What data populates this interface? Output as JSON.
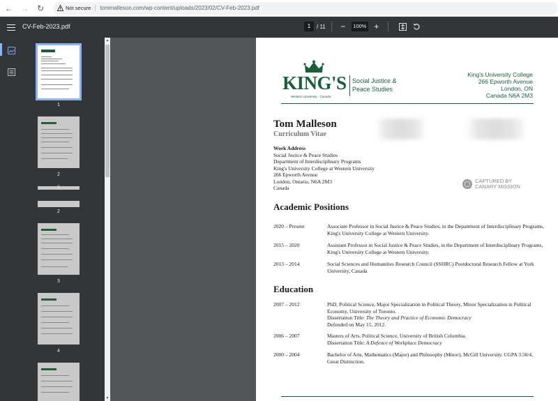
{
  "browser": {
    "not_secure": "Not secure",
    "url": "tommalleson.com/wp-content/uploads/2023/02/CV-Feb-2023.pdf"
  },
  "toolbar": {
    "file_name": "CV-Feb-2023.pdf",
    "current_page": "1",
    "total_pages": "/ 11",
    "zoom": "100%"
  },
  "thumbnails": {
    "labels": [
      "1",
      "2",
      "2",
      "2",
      "3",
      "4"
    ]
  },
  "document": {
    "logo_text": "KING'S",
    "logo_sub": "Social Justice & Peace Studies",
    "logo_tag": "Western University · Canada",
    "address_right": [
      "King's University College",
      "266 Epworth Avenue",
      "London, ON",
      "Canada N6A 2M3"
    ],
    "name": "Tom Malleson",
    "subtitle": "Curriculum Vitae",
    "work_address_label": "Work Address",
    "work_address": [
      "Social Justice & Peace Studies",
      "Department of Interdisciplinary Programs",
      "King's University College at Western University",
      "266 Epworth Avenue",
      "London, Ontario, N6A 2M3",
      "Canada"
    ],
    "captured": [
      "CAPTURED BY",
      "CANARY MISSION"
    ],
    "academic_title": "Academic Positions",
    "academic": [
      {
        "years": "2020 – Present",
        "desc": "Associate Professor in Social Justice & Peace Studies, in the Department of Interdisciplinary Programs, King's University College at Western University."
      },
      {
        "years": "2015 – 2020",
        "desc": "Assistant Professor in Social Justice & Peace Studies, in the Department of Interdisciplinary Programs, King's University College at Western University."
      },
      {
        "years": "2013 – 2014",
        "desc": "Social Sciences and Humanities Research Council (SSHRC) Postdoctoral Research Fellow at York University, Canada"
      }
    ],
    "education_title": "Education",
    "education": [
      {
        "years": "2007 – 2012",
        "line1": "PhD, Political Science, Major Specialization in Political Theory, Minor Specialization in Political Economy, University of Toronto.",
        "diss_label": "Dissertation Title: ",
        "diss_title": "The Theory and Practice of Economic Democracy",
        "line3": "Defended on May 15, 2012."
      },
      {
        "years": "2006 – 2007",
        "line1": "Masters of Arts, Political Science, University of British Columbia.",
        "diss_label": "Dissertation Title: ",
        "diss_title": "A Defence of Workplace Democracy"
      },
      {
        "years": "2000 – 2004",
        "line1": "Bachelor of Arts, Mathematics (Major) and Philosophy (Minor), McGill University. CGPA 3.50/4, Great Distinction."
      }
    ]
  }
}
